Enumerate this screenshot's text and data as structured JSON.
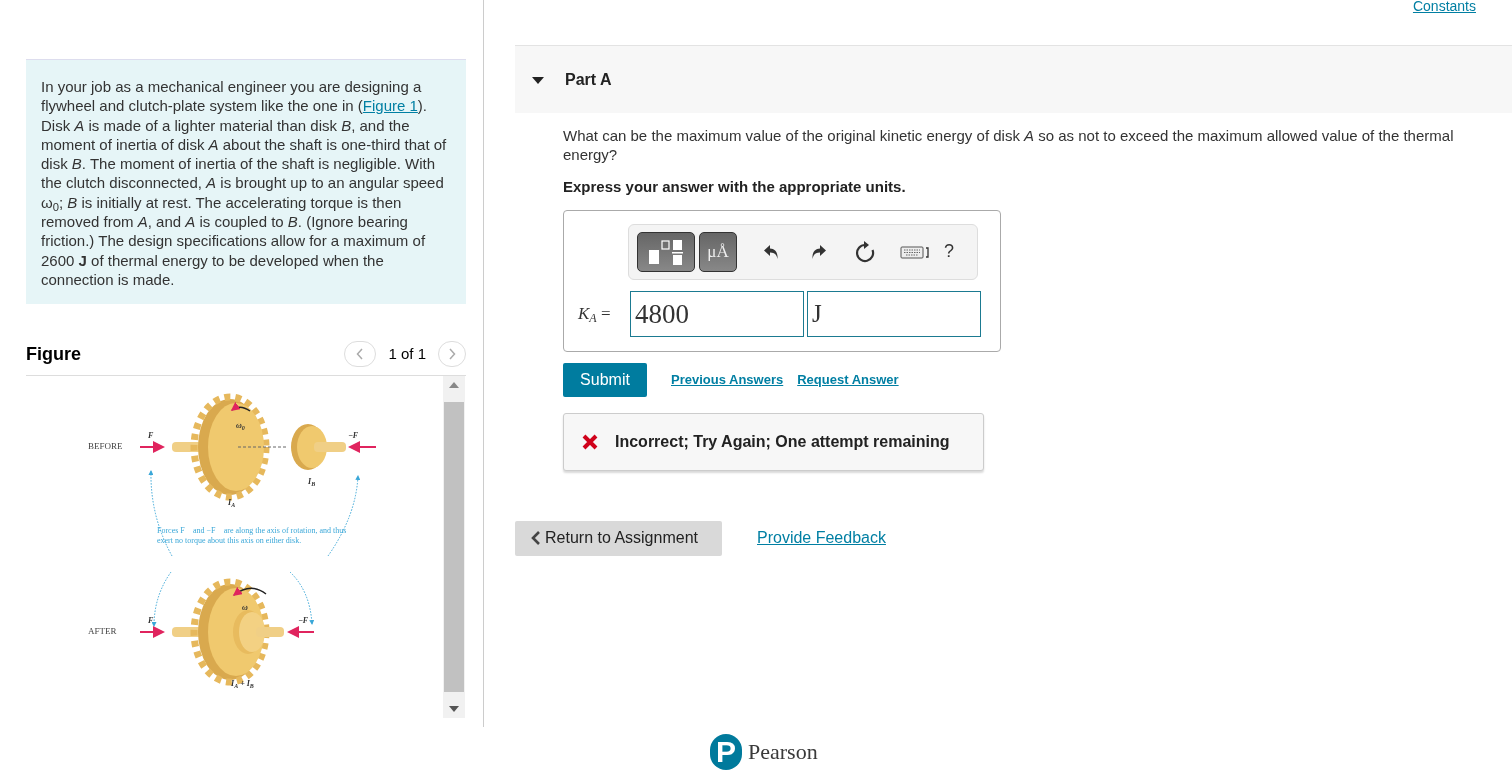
{
  "header_link": "Constants",
  "problem": {
    "before": "In your job as a mechanical engineer you are designing a flywheel and clutch-plate system like the one in (",
    "link": "Figure 1",
    "after": "). Disk *A* is made of a lighter material than disk *B*, and the moment of inertia of disk *A* about the shaft is one-third that of disk *B*. The moment of inertia of the shaft is negligible. With the clutch disconnected, *A* is brought up to an angular speed ω$_{0}$; *B* is initially at rest. The accelerating torque is then removed from *A*, and *A* is coupled to *B*. (Ignore bearing friction.) The design specifications allow for a maximum of 2600 **J** of thermal energy to be developed when the connection is made."
  },
  "figure": {
    "title": "Figure",
    "pager": "1 of 1",
    "labels": [
      {
        "kind": "stage",
        "text": "BEFORE"
      },
      {
        "kind": "force",
        "text": "F⃗"
      },
      {
        "kind": "force",
        "text": "−F⃗"
      },
      {
        "kind": "symbol",
        "text": "ω$_{0}$"
      },
      {
        "kind": "symbol",
        "text": "I$_{A}$"
      },
      {
        "kind": "symbol",
        "text": "I$_{B}$"
      },
      {
        "kind": "caption",
        "text": "Forces F⃗ and −F⃗ are along the axis of rotation, and thus exert no torque about this axis on either disk."
      },
      {
        "kind": "stage",
        "text": "AFTER"
      },
      {
        "kind": "force",
        "text": "F⃗"
      },
      {
        "kind": "force",
        "text": "−F⃗"
      },
      {
        "kind": "symbol",
        "text": "ω"
      },
      {
        "kind": "symbol",
        "text": "I$_{A}$ + I$_{B}$"
      }
    ]
  },
  "part": {
    "title": "Part A",
    "expanded": true,
    "question": "What can be the maximum value of the original kinetic energy of disk *A* so as not to exceed the maximum allowed value of the thermal energy?",
    "instruction": "Express your answer with the appropriate units.",
    "toolbar": {
      "units_button": "μÅ",
      "help": "?"
    },
    "answer": {
      "label": "*K*$_{A}$ =",
      "value": "4800",
      "unit": "J"
    },
    "submit": "Submit",
    "links": [
      "Previous Answers",
      "Request Answer"
    ],
    "feedback": {
      "kind": "incorrect",
      "text": "Incorrect; Try Again; One attempt remaining"
    }
  },
  "footer": {
    "return": "Return to Assignment",
    "feedback_link": "Provide Feedback",
    "logo_mark": "P",
    "logo": "Pearson"
  }
}
